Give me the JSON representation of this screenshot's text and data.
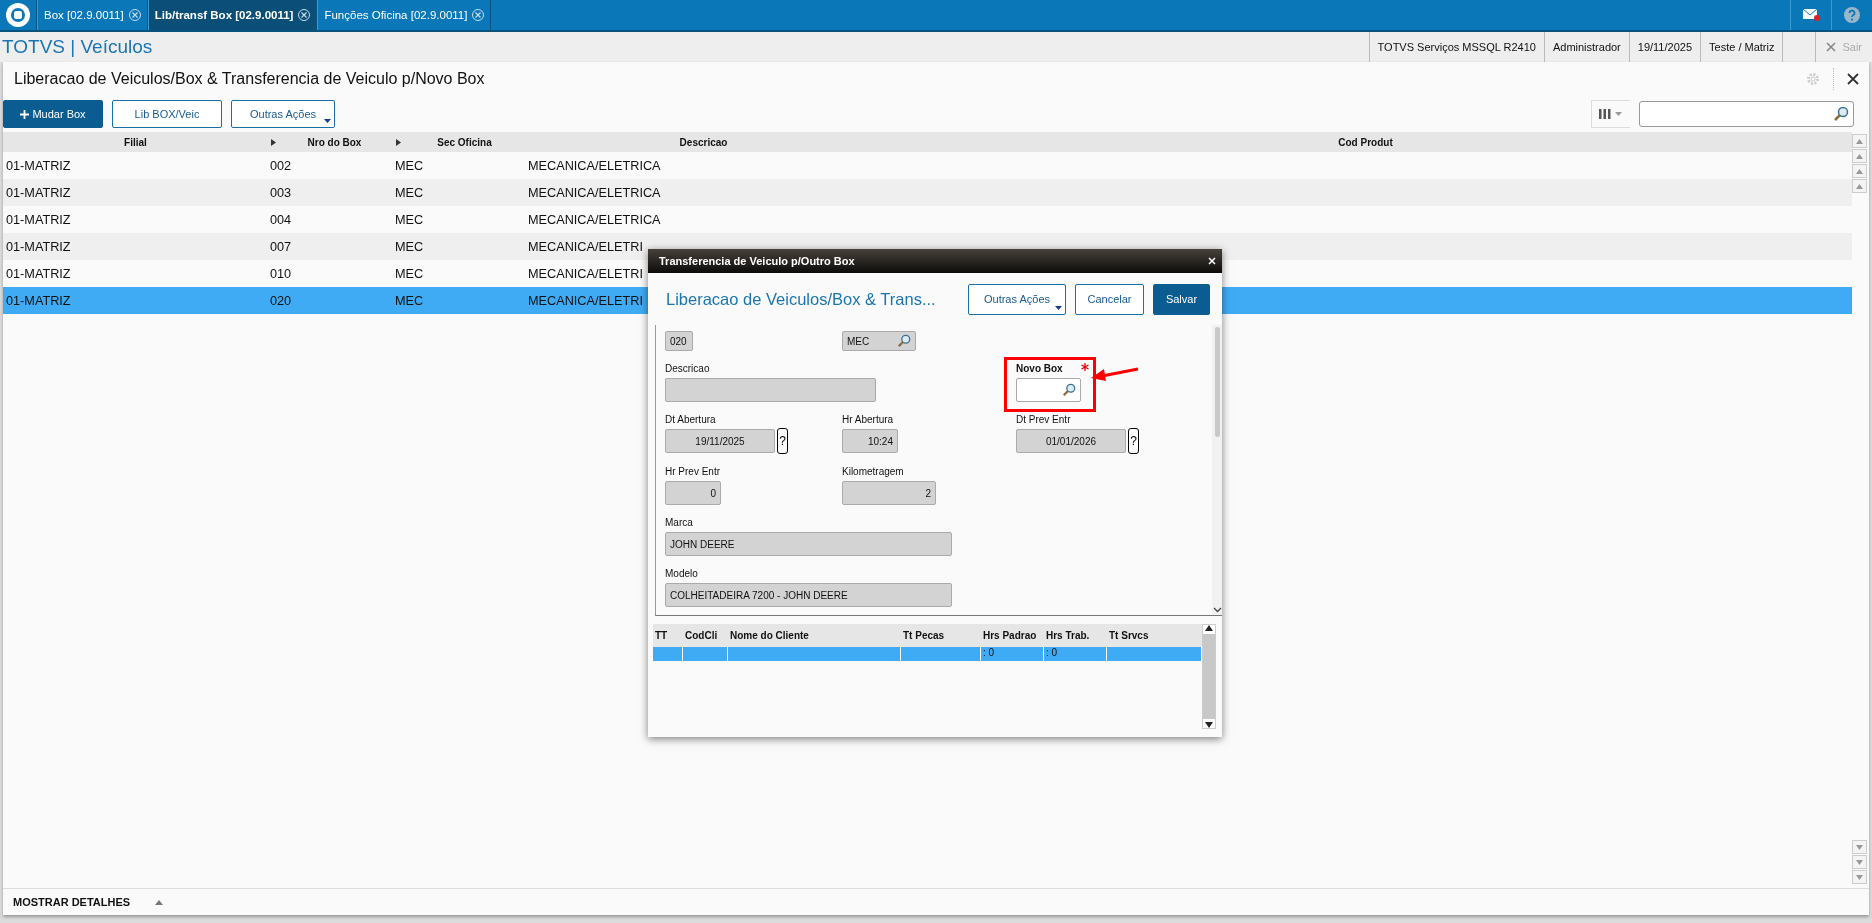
{
  "tabs": [
    {
      "label": "Box [02.9.0011]",
      "selected": false
    },
    {
      "label": "Lib/transf Box [02.9.0011]",
      "selected": true
    },
    {
      "label": "Funções Oficina [02.9.0011]",
      "selected": false
    }
  ],
  "app_title": "TOTVS | Veículos",
  "status_items": [
    "TOTVS Serviços MSSQL R2410",
    "Administrador",
    "19/11/2025",
    "Teste / Matriz"
  ],
  "exit": {
    "label": "Sair",
    "disabled": true
  },
  "page_title": "Liberacao de Veiculos/Box & Transferencia de Veiculo p/Novo Box",
  "toolbar": [
    {
      "label": "Mudar Box",
      "kind": "primary"
    },
    {
      "label": "Lib BOX/Veic",
      "kind": "plain"
    },
    {
      "label": "Outras Ações",
      "kind": "menu"
    }
  ],
  "table": {
    "columns": [
      {
        "label": "Filial",
        "marker": false
      },
      {
        "label": "Nro do Box",
        "marker": true
      },
      {
        "label": "Sec Oficina",
        "marker": true
      },
      {
        "label": "Descricao",
        "marker": false
      },
      {
        "label": "Cod Produt",
        "marker": false
      }
    ],
    "rows": [
      {
        "cells": [
          "01-MATRIZ",
          "002",
          "MEC",
          "MECANICA/ELETRICA"
        ],
        "selected": false
      },
      {
        "cells": [
          "01-MATRIZ",
          "003",
          "MEC",
          "MECANICA/ELETRICA"
        ],
        "selected": false
      },
      {
        "cells": [
          "01-MATRIZ",
          "004",
          "MEC",
          "MECANICA/ELETRICA"
        ],
        "selected": false
      },
      {
        "cells": [
          "01-MATRIZ",
          "007",
          "MEC",
          "MECANICA/ELETRI"
        ],
        "selected": false
      },
      {
        "cells": [
          "01-MATRIZ",
          "010",
          "MEC",
          "MECANICA/ELETRI"
        ],
        "selected": false
      },
      {
        "cells": [
          "01-MATRIZ",
          "020",
          "MEC",
          "MECANICA/ELETRI"
        ],
        "selected": true
      }
    ]
  },
  "details_toggle": "MOSTRAR DETALHES",
  "dialog": {
    "title": "Transferencia de Veiculo p/Outro Box",
    "heading": "Liberacao de Veiculos/Box & Trans...",
    "buttons": [
      {
        "label": "Outras Ações",
        "kind": "menu"
      },
      {
        "label": "Cancelar",
        "kind": "plain"
      },
      {
        "label": "Salvar",
        "kind": "primary"
      }
    ],
    "form_rows": [
      [
        {
          "kind": "short",
          "value": "020"
        },
        {
          "kind": "lookup",
          "value": "MEC"
        }
      ],
      [
        {
          "kind": "wide",
          "label": "Descricao"
        },
        {
          "kind": "entry",
          "label": "Novo Box",
          "required": true
        }
      ],
      [
        {
          "kind": "date",
          "label": "Dt Abertura",
          "value": "19/11/2025",
          "help": "?"
        },
        {
          "kind": "time",
          "label": "Hr Abertura",
          "value": "10:24"
        },
        {
          "kind": "date",
          "label": "Dt Prev Entr",
          "value": "01/01/2026",
          "help": "?"
        }
      ],
      [
        {
          "kind": "time",
          "label": "Hr Prev Entr",
          "value": "0"
        },
        {
          "kind": "number",
          "label": "Kilometragem",
          "value": "2"
        }
      ],
      [
        {
          "kind": "wide",
          "label": "Marca",
          "value": "JOHN DEERE"
        }
      ],
      [
        {
          "kind": "wide",
          "label": "Modelo",
          "value": "COLHEITADEIRA 7200 - JOHN DEERE"
        }
      ]
    ],
    "grid": {
      "columns": [
        "TT",
        "CodCli",
        "Nome do Cliente",
        "Tt Pecas",
        "Hrs Padrao",
        "Hrs Trab.",
        "Tt Srvcs"
      ],
      "rows": [
        {
          "cells": [
            null,
            null,
            null,
            null,
            ": 0",
            ": 0",
            null
          ],
          "selected": true
        }
      ]
    }
  }
}
